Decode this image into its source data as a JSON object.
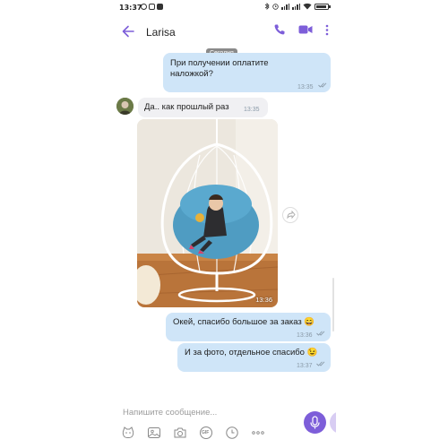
{
  "status_bar": {
    "time": "13:37",
    "icons": [
      "viber-icon",
      "instagram-icon",
      "app-icon",
      "bluetooth-icon",
      "alarm-icon",
      "signal-icon",
      "signal-icon",
      "wifi-icon",
      "battery-icon"
    ]
  },
  "header": {
    "contact_name": "Larisa",
    "icons": [
      "back-arrow-icon",
      "phone-icon",
      "video-call-icon",
      "more-vertical-icon"
    ]
  },
  "date_separator": "Сегодня",
  "messages": [
    {
      "direction": "outgoing",
      "text": "При получении оплатите наложкой?",
      "time": "13:35",
      "status": "read"
    },
    {
      "direction": "incoming",
      "text": "Да.. как прошлый раз",
      "time": "13:35"
    },
    {
      "direction": "incoming",
      "type": "photo",
      "time": "13:36"
    },
    {
      "direction": "outgoing",
      "text": "Окей, спасибо большое за заказ 😄",
      "time": "13:36",
      "status": "read"
    },
    {
      "direction": "outgoing",
      "text": "И за фото, отдельное спасибо 😉",
      "time": "13:37",
      "status": "read"
    }
  ],
  "composer": {
    "placeholder": "Напишите сообщение...",
    "tools": [
      "sticker-icon",
      "gallery-icon",
      "camera-icon",
      "gif-icon",
      "timer-icon",
      "more-icon"
    ],
    "gif_label": "GIF"
  },
  "colors": {
    "accent": "#7d5ed9",
    "outgoing_bubble": "#cfe5f8",
    "incoming_bubble": "#f0f0f3"
  }
}
